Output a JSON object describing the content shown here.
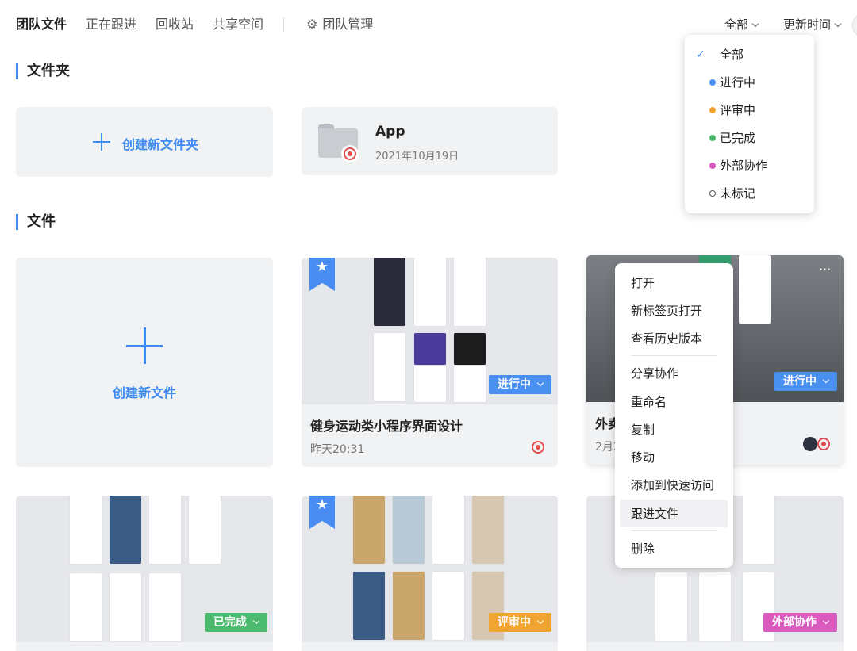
{
  "nav": {
    "tabs": [
      "团队文件",
      "正在跟进",
      "回收站",
      "共享空间"
    ],
    "settings_label": "团队管理"
  },
  "sort": {
    "filter_label": "全部",
    "order_label": "更新时间"
  },
  "filter_menu": {
    "items": [
      {
        "label": "全部",
        "marker": "check",
        "color": "#3d8bf0"
      },
      {
        "label": "进行中",
        "marker": "dot",
        "color": "#4a90f0"
      },
      {
        "label": "评审中",
        "marker": "dot",
        "color": "#f0a432"
      },
      {
        "label": "已完成",
        "marker": "dot",
        "color": "#4cba6e"
      },
      {
        "label": "外部协作",
        "marker": "dot",
        "color": "#d95bc0"
      },
      {
        "label": "未标记",
        "marker": "ring",
        "color": "#555555"
      }
    ]
  },
  "folders": {
    "title": "文件夹",
    "create_label": "创建新文件夹",
    "items": [
      {
        "name": "App",
        "date": "2021年10月19日"
      }
    ]
  },
  "files": {
    "title": "文件",
    "create_label": "创建新文件",
    "items": [
      {
        "name": "健身运动类小程序界面设计",
        "date": "昨天20:31",
        "status": "进行中",
        "starred": true
      },
      {
        "name": "外卖",
        "date": "2月2",
        "status": "进行中",
        "starred": false
      },
      {
        "name": "",
        "date": "",
        "status": "已完成",
        "starred": false
      },
      {
        "name": "",
        "date": "",
        "status": "评审中",
        "starred": true
      },
      {
        "name": "",
        "date": "",
        "status": "外部协作",
        "starred": false
      }
    ]
  },
  "context_menu": {
    "items": [
      "打开",
      "新标签页打开",
      "查看历史版本",
      "分享协作",
      "重命名",
      "复制",
      "移动",
      "添加到快速访问",
      "跟进文件",
      "删除"
    ]
  },
  "colors": {
    "accent": "#3d8bf0",
    "in_progress": "#4a90f0",
    "done": "#4cba6e",
    "review": "#f0a432",
    "external": "#d95bc0",
    "logo": "#e34c4c"
  }
}
